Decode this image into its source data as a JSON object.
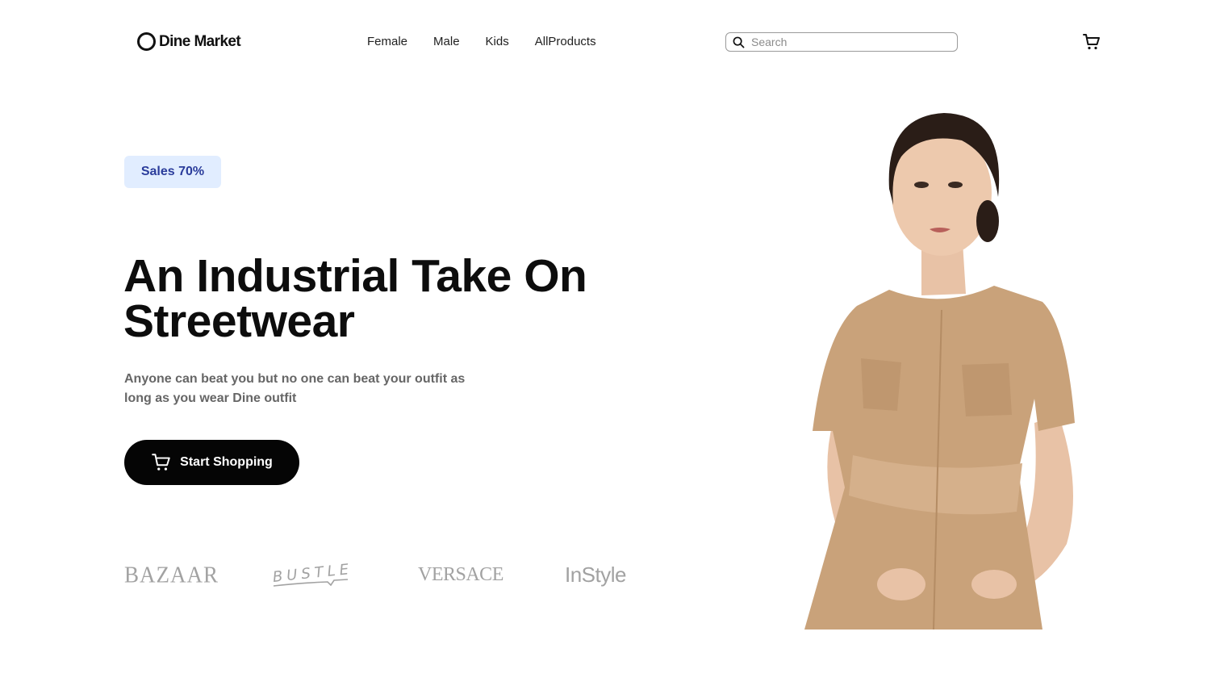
{
  "header": {
    "brand_name": "Dine Market",
    "nav": [
      "Female",
      "Male",
      "Kids",
      "AllProducts"
    ],
    "search": {
      "placeholder": "Search",
      "value": ""
    },
    "icons": {
      "search": "search-icon",
      "cart": "cart-icon",
      "logo": "ring-logo-icon"
    }
  },
  "hero": {
    "badge": "Sales 70%",
    "title": "An Industrial Take On Streetwear",
    "subtitle": "Anyone can beat you but no one can beat your outfit as long as you wear Dine outfit",
    "cta_label": "Start Shopping",
    "cta_icon": "cart-icon"
  },
  "brands": [
    "BAZAAR",
    "BUSTLE",
    "VERSACE",
    "InStyle"
  ],
  "colors": {
    "badge_bg": "#e1edff",
    "badge_text": "#2a3c9b",
    "cta_bg": "#050505",
    "subtitle": "#666666",
    "brand_logo": "#a2a2a2",
    "dress": "#c9a27a"
  }
}
